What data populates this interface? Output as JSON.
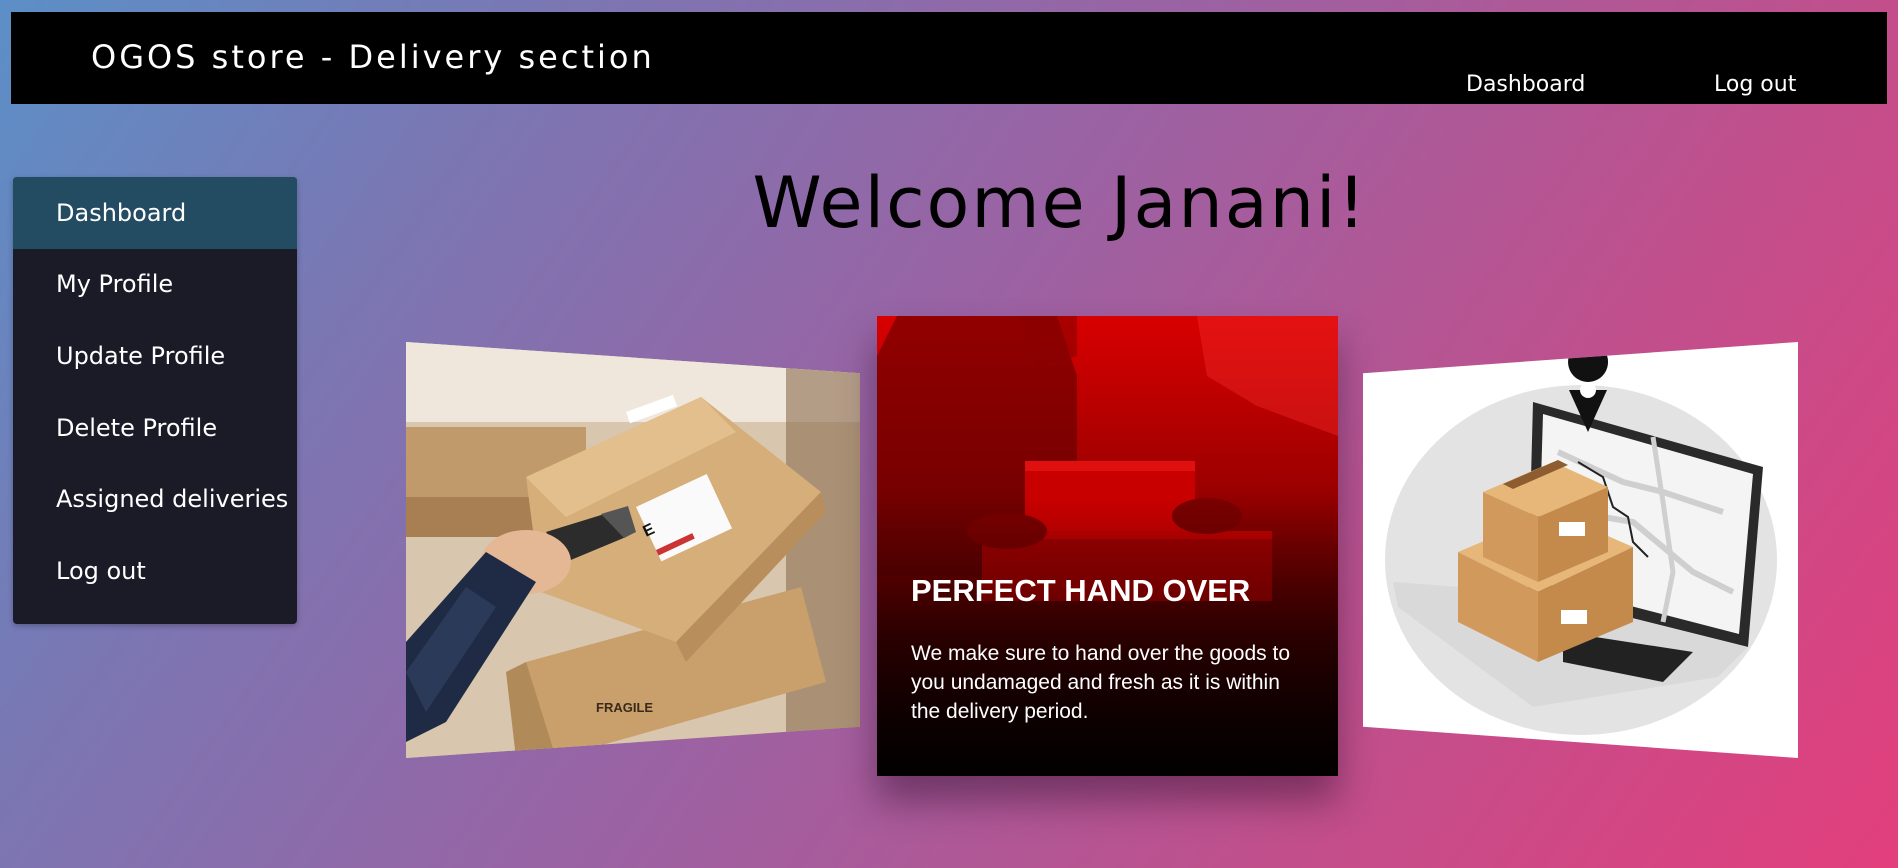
{
  "header": {
    "title": "OGOS store - Delivery section",
    "links": {
      "dashboard": "Dashboard",
      "logout": "Log out"
    }
  },
  "sidebar": {
    "items": [
      {
        "label": "Dashboard",
        "active": true
      },
      {
        "label": "My Profile"
      },
      {
        "label": "Update Profile"
      },
      {
        "label": "Delete Profile"
      },
      {
        "label": "Assigned deliveries"
      },
      {
        "label": "Log out"
      }
    ]
  },
  "main": {
    "welcome": "Welcome Janani!"
  },
  "carousel": {
    "center": {
      "title": "PERFECT HAND OVER",
      "text": "We make sure to hand over the goods to you undamaged and fresh as it is within the delivery period."
    },
    "left_box_label": "FRAGILE",
    "left_label_letter": "E"
  },
  "colors": {
    "topbar": "#000000",
    "sidebar_bg": "#1b1b28",
    "sidebar_active": "#234b62",
    "gradient_start": "#5c8fc7",
    "gradient_end": "#e23f7c",
    "card_red": "#d80000"
  }
}
